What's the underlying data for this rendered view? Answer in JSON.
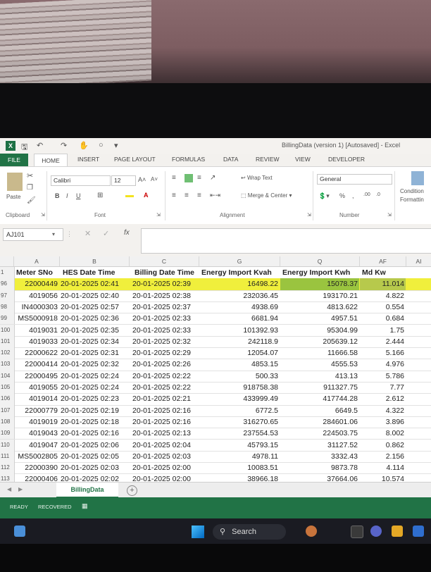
{
  "window": {
    "title": "BillingData (version 1) [Autosaved] - Excel",
    "logo": "X"
  },
  "tabs": [
    "FILE",
    "HOME",
    "INSERT",
    "PAGE LAYOUT",
    "FORMULAS",
    "DATA",
    "REVIEW",
    "VIEW",
    "DEVELOPER"
  ],
  "ribbon": {
    "paste": "Paste",
    "font_name": "Calibri",
    "font_size": "12",
    "grow": "A˄",
    "shrink": "A˅",
    "bold": "B",
    "italic": "I",
    "underline": "U",
    "wrap_text": "Wrap Text",
    "merge_center": "Merge & Center",
    "number_format": "General",
    "percent": "%",
    "comma": ",",
    "cond_format_1": "Condition",
    "cond_format_2": "Formattin",
    "group_clipboard": "Clipboard",
    "group_font": "Font",
    "group_alignment": "Alignment",
    "group_number": "Number"
  },
  "formula_bar": {
    "name_box": "AJ101",
    "fx": "fx",
    "content": ""
  },
  "grid": {
    "col_letters": [
      "A",
      "B",
      "C",
      "G",
      "Q",
      "AF",
      "AI"
    ],
    "header_row_num": "1",
    "headers": [
      "Meter SNo",
      "HES Date Time",
      "Billing Date Time",
      "Energy Import Kvah",
      "Energy Import Kwh",
      "Md Kw"
    ],
    "rows": [
      {
        "n": "96",
        "a": "22000449",
        "b": "20-01-2025 02:41",
        "c": "20-01-2025 02:39",
        "g": "16498.22",
        "q": "15078.37",
        "af": "11.014"
      },
      {
        "n": "97",
        "a": "4019056",
        "b": "20-01-2025 02:40",
        "c": "20-01-2025 02:38",
        "g": "232036.45",
        "q": "193170.21",
        "af": "4.822"
      },
      {
        "n": "98",
        "a": "IN4000303",
        "b": "20-01-2025 02:57",
        "c": "20-01-2025 02:37",
        "g": "4938.69",
        "q": "4813.622",
        "af": "0.554"
      },
      {
        "n": "99",
        "a": "MS5000918",
        "b": "20-01-2025 02:36",
        "c": "20-01-2025 02:33",
        "g": "6681.94",
        "q": "4957.51",
        "af": "0.684"
      },
      {
        "n": "100",
        "a": "4019031",
        "b": "20-01-2025 02:35",
        "c": "20-01-2025 02:33",
        "g": "101392.93",
        "q": "95304.99",
        "af": "1.75"
      },
      {
        "n": "101",
        "a": "4019033",
        "b": "20-01-2025 02:34",
        "c": "20-01-2025 02:32",
        "g": "242118.9",
        "q": "205639.12",
        "af": "2.444"
      },
      {
        "n": "102",
        "a": "22000622",
        "b": "20-01-2025 02:31",
        "c": "20-01-2025 02:29",
        "g": "12054.07",
        "q": "11666.58",
        "af": "5.166"
      },
      {
        "n": "103",
        "a": "22000414",
        "b": "20-01-2025 02:32",
        "c": "20-01-2025 02:26",
        "g": "4853.15",
        "q": "4555.53",
        "af": "4.976"
      },
      {
        "n": "104",
        "a": "22000495",
        "b": "20-01-2025 02:24",
        "c": "20-01-2025 02:22",
        "g": "500.33",
        "q": "413.13",
        "af": "5.786"
      },
      {
        "n": "105",
        "a": "4019055",
        "b": "20-01-2025 02:24",
        "c": "20-01-2025 02:22",
        "g": "918758.38",
        "q": "911327.75",
        "af": "7.77"
      },
      {
        "n": "106",
        "a": "4019014",
        "b": "20-01-2025 02:23",
        "c": "20-01-2025 02:21",
        "g": "433999.49",
        "q": "417744.28",
        "af": "2.612"
      },
      {
        "n": "107",
        "a": "22000779",
        "b": "20-01-2025 02:19",
        "c": "20-01-2025 02:16",
        "g": "6772.5",
        "q": "6649.5",
        "af": "4.322"
      },
      {
        "n": "108",
        "a": "4019019",
        "b": "20-01-2025 02:18",
        "c": "20-01-2025 02:16",
        "g": "316270.65",
        "q": "284601.06",
        "af": "3.896"
      },
      {
        "n": "109",
        "a": "4019043",
        "b": "20-01-2025 02:16",
        "c": "20-01-2025 02:13",
        "g": "237554.53",
        "q": "224503.75",
        "af": "8.002"
      },
      {
        "n": "110",
        "a": "4019047",
        "b": "20-01-2025 02:06",
        "c": "20-01-2025 02:04",
        "g": "45793.15",
        "q": "31127.52",
        "af": "0.862"
      },
      {
        "n": "111",
        "a": "MS5002805",
        "b": "20-01-2025 02:05",
        "c": "20-01-2025 02:03",
        "g": "4978.11",
        "q": "3332.43",
        "af": "2.156"
      },
      {
        "n": "112",
        "a": "22000390",
        "b": "20-01-2025 02:03",
        "c": "20-01-2025 02:00",
        "g": "10083.51",
        "q": "9873.78",
        "af": "4.114"
      },
      {
        "n": "113",
        "a": "22000406",
        "b": "20-01-2025 02:02",
        "c": "20-01-2025 02:00",
        "g": "38966.18",
        "q": "37664.06",
        "af": "10.574"
      }
    ]
  },
  "sheet_tab": "BillingData",
  "add_sheet": "+",
  "status": {
    "ready": "READY",
    "recovered": "RECOVERED"
  },
  "taskbar": {
    "search": "Search"
  }
}
